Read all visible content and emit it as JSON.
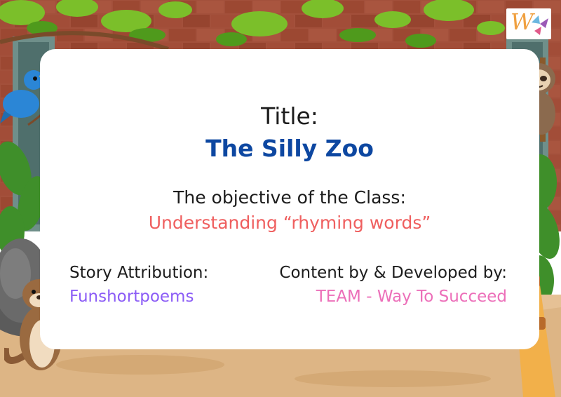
{
  "card": {
    "title_label": "Title:",
    "title": "The Silly Zoo",
    "objective_label": "The objective of the Class:",
    "objective": "Understanding “rhyming words”",
    "attribution_label": "Story Attribution:",
    "attribution": "Funshortpoems",
    "developer_label": "Content by & Developed by:",
    "developer": "TEAM - Way To Succeed"
  },
  "logo": {
    "letter": "W"
  },
  "icons": [
    "music-note-icon",
    "bird-icon",
    "giraffe-icon",
    "sloth-icon",
    "otter-icon"
  ],
  "colors": {
    "title": "#0d47a1",
    "objective": "#ef5f5f",
    "attribution": "#8b5cf6",
    "developer": "#ec6fb9",
    "brick": "#9c4a35",
    "ground": "#e8c497"
  }
}
